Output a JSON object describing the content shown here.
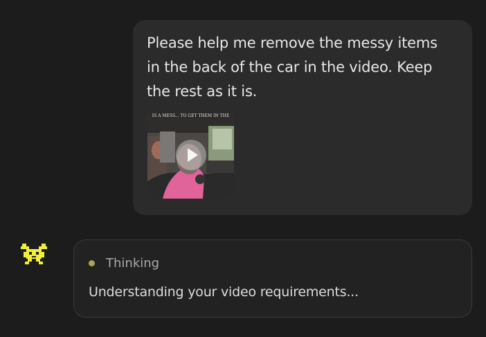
{
  "user_message": {
    "text": "Please help me remove the messy items in the back of the car in the video. Keep the rest as it is.",
    "attachment": {
      "type": "video",
      "caption": "IS A MESS... TO GET THEM IN THE",
      "icon": "play-icon"
    }
  },
  "assistant": {
    "avatar_icon": "pixel-bug-icon",
    "status": {
      "label": "Thinking",
      "dot_color": "#a8a653"
    },
    "detail": "Understanding your video requirements..."
  },
  "colors": {
    "background": "#1c1c1c",
    "bubble": "#2b2b2b",
    "avatar": "#f2ef3c"
  }
}
